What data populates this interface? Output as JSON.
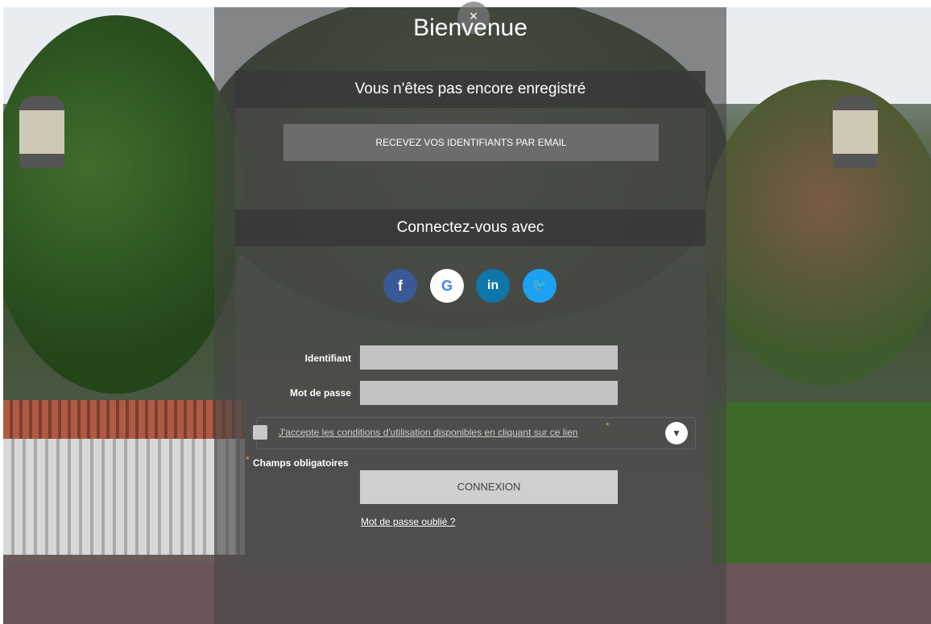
{
  "dialog": {
    "title": "Bienvenue",
    "close_symbol": "×",
    "not_registered_heading": "Vous n'êtes pas encore enregistré",
    "email_button_label": "RECEVEZ VOS IDENTIFIANTS PAR EMAIL",
    "connect_with_heading": "Connectez-vous avec",
    "social": [
      {
        "name": "facebook",
        "glyph": "f",
        "color": "#3b5998"
      },
      {
        "name": "google",
        "glyph": "G",
        "color": "#4285f4"
      },
      {
        "name": "linkedin",
        "glyph": "in",
        "color": "#0e76a8"
      },
      {
        "name": "twitter",
        "glyph": "🐦",
        "color": "#1da1f2"
      }
    ],
    "form": {
      "identifiant_label": "Identifiant",
      "identifiant_value": "",
      "password_label": "Mot de passe",
      "password_value": "",
      "terms_text": "J'accepte les conditions d'utilisation disponibles en cliquant sur ce lien",
      "terms_required_marker": "*",
      "required_note": "Champs obligatoires",
      "required_marker": "*",
      "connect_button_label": "CONNEXION",
      "forgot_password_link": "Mot de passe oublié ?",
      "toggle_icon": "▼"
    }
  }
}
